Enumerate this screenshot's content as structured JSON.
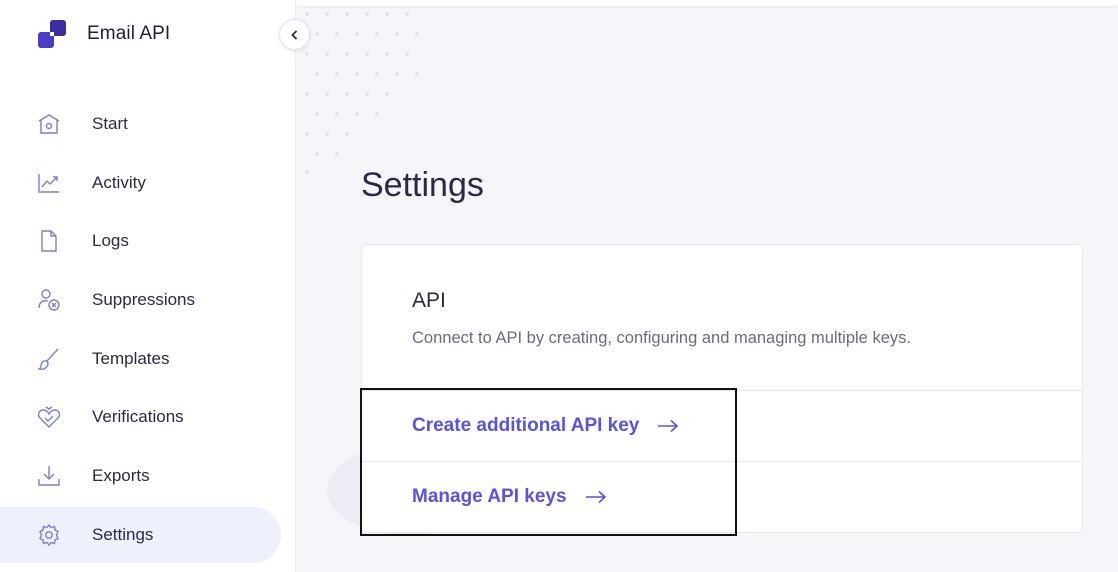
{
  "brand": {
    "name": "Email API"
  },
  "sidebar": {
    "items": [
      {
        "label": "Start",
        "icon": "home-icon"
      },
      {
        "label": "Activity",
        "icon": "activity-chart-icon"
      },
      {
        "label": "Logs",
        "icon": "document-icon"
      },
      {
        "label": "Suppressions",
        "icon": "user-block-icon"
      },
      {
        "label": "Templates",
        "icon": "brush-icon"
      },
      {
        "label": "Verifications",
        "icon": "heart-check-icon"
      },
      {
        "label": "Exports",
        "icon": "download-icon"
      },
      {
        "label": "Settings",
        "icon": "gear-icon",
        "active": true
      }
    ]
  },
  "main": {
    "title": "Settings",
    "card": {
      "title": "API",
      "description": "Connect to API by creating, configuring and managing multiple keys.",
      "links": [
        {
          "label": "Create additional API key"
        },
        {
          "label": "Manage API keys"
        }
      ]
    }
  },
  "colors": {
    "accent": "#5a52e0",
    "brand_logo": "#3b2d9e",
    "icon": "#7b7fd1",
    "active_bg": "#eef0fb"
  }
}
